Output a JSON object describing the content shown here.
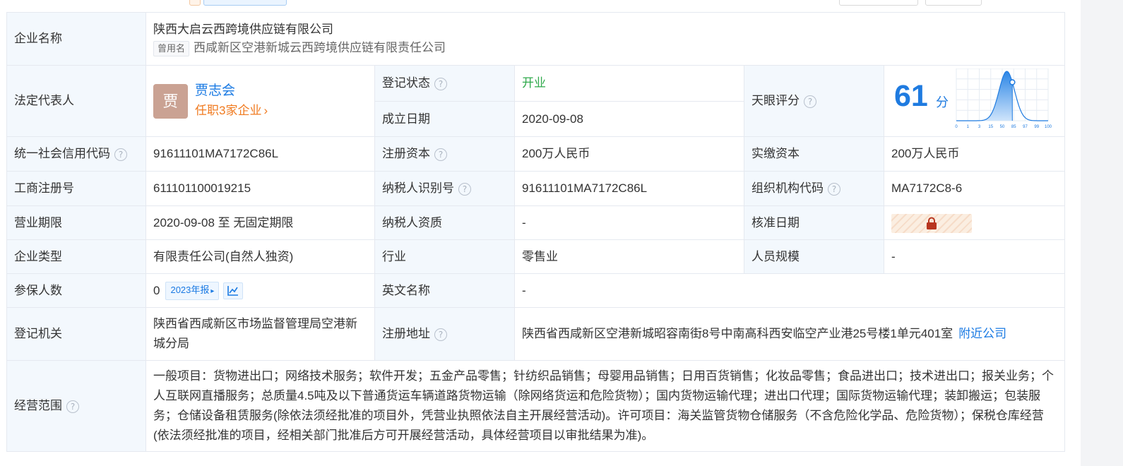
{
  "company": {
    "name_label": "企业名称",
    "name": "陕西大启云西跨境供应链有限公司",
    "former_tag": "曾用名",
    "former_name": "西咸新区空港新城云西跨境供应链有限责任公司"
  },
  "legal": {
    "label": "法定代表人",
    "avatar_char": "贾",
    "name": "贾志会",
    "roles": "任职3家企业",
    "roles_arrow": "›"
  },
  "registration": {
    "status_label": "登记状态",
    "status": "开业",
    "status_color": "#2fa94b",
    "found_label": "成立日期",
    "found_date": "2020-09-08"
  },
  "score": {
    "label": "天眼评分",
    "value": "61",
    "unit": "分",
    "value_fraction": 0.61,
    "axis_ticks": [
      "0",
      "1",
      "3",
      "15",
      "50",
      "85",
      "97",
      "99",
      "100"
    ]
  },
  "rows": {
    "credit_label": "统一社会信用代码",
    "credit": "91611101MA7172C86L",
    "reg_capital_label": "注册资本",
    "reg_capital": "200万人民币",
    "paid_capital_label": "实缴资本",
    "paid_capital": "200万人民币",
    "biz_reg_label": "工商注册号",
    "biz_reg": "611101100019215",
    "taxpayer_id_label": "纳税人识别号",
    "taxpayer_id": "91611101MA7172C86L",
    "org_code_label": "组织机构代码",
    "org_code": "MA7172C8-6",
    "term_label": "营业期限",
    "term": "2020-09-08 至 无固定期限",
    "taxpayer_qual_label": "纳税人资质",
    "taxpayer_qual": "-",
    "approve_label": "核准日期",
    "type_label": "企业类型",
    "type": "有限责任公司(自然人独资)",
    "industry_label": "行业",
    "industry": "零售业",
    "staff_label": "人员规模",
    "staff": "-",
    "insured_label": "参保人数",
    "insured": "0",
    "report_tag": "2023年报",
    "report_arrow": "▸",
    "english_label": "英文名称",
    "english": "-",
    "authority_label": "登记机关",
    "authority": "陕西省西咸新区市场监督管理局空港新城分局",
    "address_label": "注册地址",
    "address": "陕西省西咸新区空港新城昭容南街8号中南高科西安临空产业港25号楼1单元401室",
    "nearby": "附近公司",
    "scope_label": "经营范围",
    "scope": "一般项目：货物进出口；网络技术服务；软件开发；五金产品零售；针纺织品销售；母婴用品销售；日用百货销售；化妆品零售；食品进出口；技术进出口；报关业务；个人互联网直播服务；总质量4.5吨及以下普通货运车辆道路货物运输（除网络货运和危险货物）；国内货物运输代理；进出口代理；国际货物运输代理；装卸搬运；包装服务；仓储设备租赁服务(除依法须经批准的项目外，凭营业执照依法自主开展经营活动)。许可项目：海关监管货物仓储服务（不含危险化学品、危险货物）；保税仓库经营(依法须经批准的项目，经相关部门批准后方可开展经营活动，具体经营项目以审批结果为准)。"
  },
  "help_glyph": "?",
  "colors": {
    "label_bg": "#f3f8fd",
    "border": "#e5e9f0",
    "link": "#1a7ae3",
    "orange": "#f07a1f"
  }
}
